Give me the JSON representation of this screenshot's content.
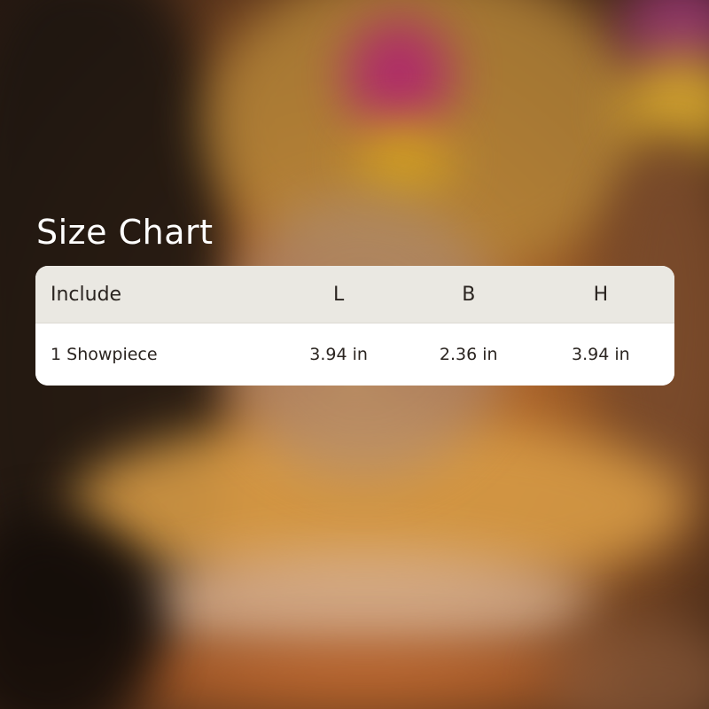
{
  "title": "Size Chart",
  "table": {
    "headers": [
      "Include",
      "L",
      "B",
      "H"
    ],
    "rows": [
      [
        "1 Showpiece",
        "3.94 in",
        "2.36 in",
        "3.94 in"
      ]
    ]
  },
  "colors": {
    "header_bg": "#eae8e2",
    "card_bg": "#ffffff",
    "title_text": "#ffffff",
    "cell_text": "#2a2420"
  }
}
